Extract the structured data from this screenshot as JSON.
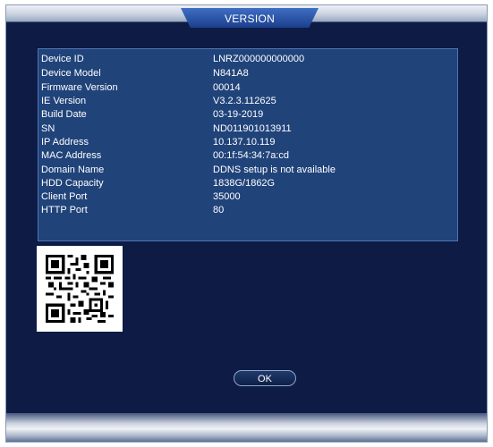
{
  "window": {
    "title": "VERSION"
  },
  "info": {
    "rows": [
      {
        "label": "Device ID",
        "value": "LNRZ000000000000"
      },
      {
        "label": "Device Model",
        "value": "N841A8"
      },
      {
        "label": "Firmware Version",
        "value": "00014"
      },
      {
        "label": "IE Version",
        "value": "V3.2.3.112625"
      },
      {
        "label": "Build Date",
        "value": "03-19-2019"
      },
      {
        "label": "SN",
        "value": "ND011901013911"
      },
      {
        "label": "IP Address",
        "value": "10.137.10.119"
      },
      {
        "label": "MAC Address",
        "value": "00:1f:54:34:7a:cd"
      },
      {
        "label": "Domain Name",
        "value": "DDNS setup is not available"
      },
      {
        "label": "HDD Capacity",
        "value": "1838G/1862G"
      },
      {
        "label": "Client Port",
        "value": "35000"
      },
      {
        "label": "HTTP Port",
        "value": "80"
      }
    ]
  },
  "qr": {
    "icon": "qr-code-icon"
  },
  "actions": {
    "ok_label": "OK"
  },
  "colors": {
    "background": "#0d1b45",
    "panel": "#20437a",
    "title_tab": "#2a55a8",
    "text": "#ffffff"
  }
}
